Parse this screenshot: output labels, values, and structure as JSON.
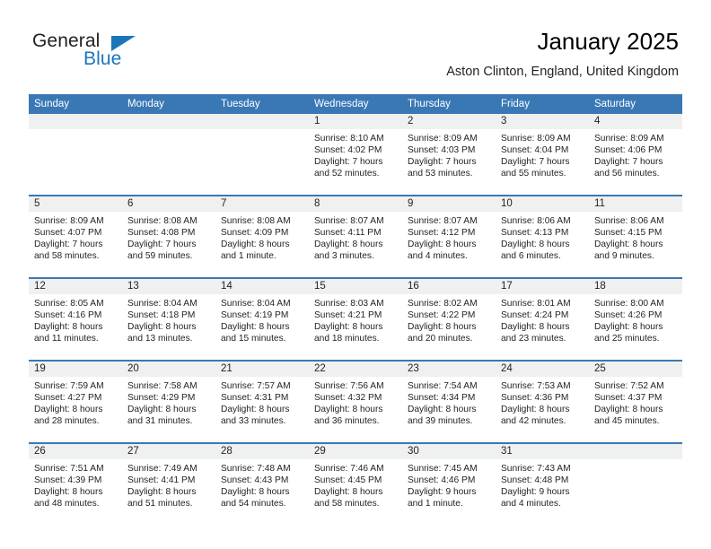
{
  "brand": {
    "name_part1": "General",
    "name_part2": "Blue",
    "logo_icon": "triangle-mark",
    "accent_color": "#1b75bb"
  },
  "header": {
    "title": "January 2025",
    "location": "Aston Clinton, England, United Kingdom"
  },
  "theme": {
    "header_blue": "#3a78b5",
    "daynum_band": "#eff0f0",
    "text": "#231f20"
  },
  "calendar": {
    "weekday_headers": [
      "Sunday",
      "Monday",
      "Tuesday",
      "Wednesday",
      "Thursday",
      "Friday",
      "Saturday"
    ],
    "weeks": [
      [
        {
          "day": "",
          "blank": true
        },
        {
          "day": "",
          "blank": true
        },
        {
          "day": "",
          "blank": true
        },
        {
          "day": "1",
          "sunrise": "Sunrise: 8:10 AM",
          "sunset": "Sunset: 4:02 PM",
          "daylight_line1": "Daylight: 7 hours",
          "daylight_line2": "and 52 minutes."
        },
        {
          "day": "2",
          "sunrise": "Sunrise: 8:09 AM",
          "sunset": "Sunset: 4:03 PM",
          "daylight_line1": "Daylight: 7 hours",
          "daylight_line2": "and 53 minutes."
        },
        {
          "day": "3",
          "sunrise": "Sunrise: 8:09 AM",
          "sunset": "Sunset: 4:04 PM",
          "daylight_line1": "Daylight: 7 hours",
          "daylight_line2": "and 55 minutes."
        },
        {
          "day": "4",
          "sunrise": "Sunrise: 8:09 AM",
          "sunset": "Sunset: 4:06 PM",
          "daylight_line1": "Daylight: 7 hours",
          "daylight_line2": "and 56 minutes."
        }
      ],
      [
        {
          "day": "5",
          "sunrise": "Sunrise: 8:09 AM",
          "sunset": "Sunset: 4:07 PM",
          "daylight_line1": "Daylight: 7 hours",
          "daylight_line2": "and 58 minutes."
        },
        {
          "day": "6",
          "sunrise": "Sunrise: 8:08 AM",
          "sunset": "Sunset: 4:08 PM",
          "daylight_line1": "Daylight: 7 hours",
          "daylight_line2": "and 59 minutes."
        },
        {
          "day": "7",
          "sunrise": "Sunrise: 8:08 AM",
          "sunset": "Sunset: 4:09 PM",
          "daylight_line1": "Daylight: 8 hours",
          "daylight_line2": "and 1 minute."
        },
        {
          "day": "8",
          "sunrise": "Sunrise: 8:07 AM",
          "sunset": "Sunset: 4:11 PM",
          "daylight_line1": "Daylight: 8 hours",
          "daylight_line2": "and 3 minutes."
        },
        {
          "day": "9",
          "sunrise": "Sunrise: 8:07 AM",
          "sunset": "Sunset: 4:12 PM",
          "daylight_line1": "Daylight: 8 hours",
          "daylight_line2": "and 4 minutes."
        },
        {
          "day": "10",
          "sunrise": "Sunrise: 8:06 AM",
          "sunset": "Sunset: 4:13 PM",
          "daylight_line1": "Daylight: 8 hours",
          "daylight_line2": "and 6 minutes."
        },
        {
          "day": "11",
          "sunrise": "Sunrise: 8:06 AM",
          "sunset": "Sunset: 4:15 PM",
          "daylight_line1": "Daylight: 8 hours",
          "daylight_line2": "and 9 minutes."
        }
      ],
      [
        {
          "day": "12",
          "sunrise": "Sunrise: 8:05 AM",
          "sunset": "Sunset: 4:16 PM",
          "daylight_line1": "Daylight: 8 hours",
          "daylight_line2": "and 11 minutes."
        },
        {
          "day": "13",
          "sunrise": "Sunrise: 8:04 AM",
          "sunset": "Sunset: 4:18 PM",
          "daylight_line1": "Daylight: 8 hours",
          "daylight_line2": "and 13 minutes."
        },
        {
          "day": "14",
          "sunrise": "Sunrise: 8:04 AM",
          "sunset": "Sunset: 4:19 PM",
          "daylight_line1": "Daylight: 8 hours",
          "daylight_line2": "and 15 minutes."
        },
        {
          "day": "15",
          "sunrise": "Sunrise: 8:03 AM",
          "sunset": "Sunset: 4:21 PM",
          "daylight_line1": "Daylight: 8 hours",
          "daylight_line2": "and 18 minutes."
        },
        {
          "day": "16",
          "sunrise": "Sunrise: 8:02 AM",
          "sunset": "Sunset: 4:22 PM",
          "daylight_line1": "Daylight: 8 hours",
          "daylight_line2": "and 20 minutes."
        },
        {
          "day": "17",
          "sunrise": "Sunrise: 8:01 AM",
          "sunset": "Sunset: 4:24 PM",
          "daylight_line1": "Daylight: 8 hours",
          "daylight_line2": "and 23 minutes."
        },
        {
          "day": "18",
          "sunrise": "Sunrise: 8:00 AM",
          "sunset": "Sunset: 4:26 PM",
          "daylight_line1": "Daylight: 8 hours",
          "daylight_line2": "and 25 minutes."
        }
      ],
      [
        {
          "day": "19",
          "sunrise": "Sunrise: 7:59 AM",
          "sunset": "Sunset: 4:27 PM",
          "daylight_line1": "Daylight: 8 hours",
          "daylight_line2": "and 28 minutes."
        },
        {
          "day": "20",
          "sunrise": "Sunrise: 7:58 AM",
          "sunset": "Sunset: 4:29 PM",
          "daylight_line1": "Daylight: 8 hours",
          "daylight_line2": "and 31 minutes."
        },
        {
          "day": "21",
          "sunrise": "Sunrise: 7:57 AM",
          "sunset": "Sunset: 4:31 PM",
          "daylight_line1": "Daylight: 8 hours",
          "daylight_line2": "and 33 minutes."
        },
        {
          "day": "22",
          "sunrise": "Sunrise: 7:56 AM",
          "sunset": "Sunset: 4:32 PM",
          "daylight_line1": "Daylight: 8 hours",
          "daylight_line2": "and 36 minutes."
        },
        {
          "day": "23",
          "sunrise": "Sunrise: 7:54 AM",
          "sunset": "Sunset: 4:34 PM",
          "daylight_line1": "Daylight: 8 hours",
          "daylight_line2": "and 39 minutes."
        },
        {
          "day": "24",
          "sunrise": "Sunrise: 7:53 AM",
          "sunset": "Sunset: 4:36 PM",
          "daylight_line1": "Daylight: 8 hours",
          "daylight_line2": "and 42 minutes."
        },
        {
          "day": "25",
          "sunrise": "Sunrise: 7:52 AM",
          "sunset": "Sunset: 4:37 PM",
          "daylight_line1": "Daylight: 8 hours",
          "daylight_line2": "and 45 minutes."
        }
      ],
      [
        {
          "day": "26",
          "sunrise": "Sunrise: 7:51 AM",
          "sunset": "Sunset: 4:39 PM",
          "daylight_line1": "Daylight: 8 hours",
          "daylight_line2": "and 48 minutes."
        },
        {
          "day": "27",
          "sunrise": "Sunrise: 7:49 AM",
          "sunset": "Sunset: 4:41 PM",
          "daylight_line1": "Daylight: 8 hours",
          "daylight_line2": "and 51 minutes."
        },
        {
          "day": "28",
          "sunrise": "Sunrise: 7:48 AM",
          "sunset": "Sunset: 4:43 PM",
          "daylight_line1": "Daylight: 8 hours",
          "daylight_line2": "and 54 minutes."
        },
        {
          "day": "29",
          "sunrise": "Sunrise: 7:46 AM",
          "sunset": "Sunset: 4:45 PM",
          "daylight_line1": "Daylight: 8 hours",
          "daylight_line2": "and 58 minutes."
        },
        {
          "day": "30",
          "sunrise": "Sunrise: 7:45 AM",
          "sunset": "Sunset: 4:46 PM",
          "daylight_line1": "Daylight: 9 hours",
          "daylight_line2": "and 1 minute."
        },
        {
          "day": "31",
          "sunrise": "Sunrise: 7:43 AM",
          "sunset": "Sunset: 4:48 PM",
          "daylight_line1": "Daylight: 9 hours",
          "daylight_line2": "and 4 minutes."
        },
        {
          "day": "",
          "blank": true
        }
      ]
    ]
  }
}
